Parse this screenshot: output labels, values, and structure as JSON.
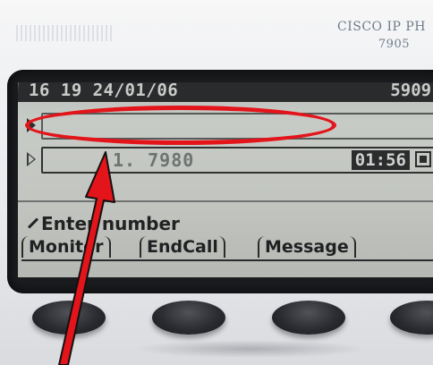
{
  "phone": {
    "brand": "CISCO IP PH",
    "model": "7905"
  },
  "screen": {
    "status_datetime": "16 19 24/01/06",
    "extension": "5909",
    "line1_text": "",
    "line2_text": "1. 7980",
    "call_timer": "01:56",
    "prompt": "Enter number",
    "softkeys": [
      "Monitor",
      "EndCall",
      "Message"
    ]
  },
  "colors": {
    "annotation": "#e3141a",
    "lcd": "#c2c5c0"
  }
}
